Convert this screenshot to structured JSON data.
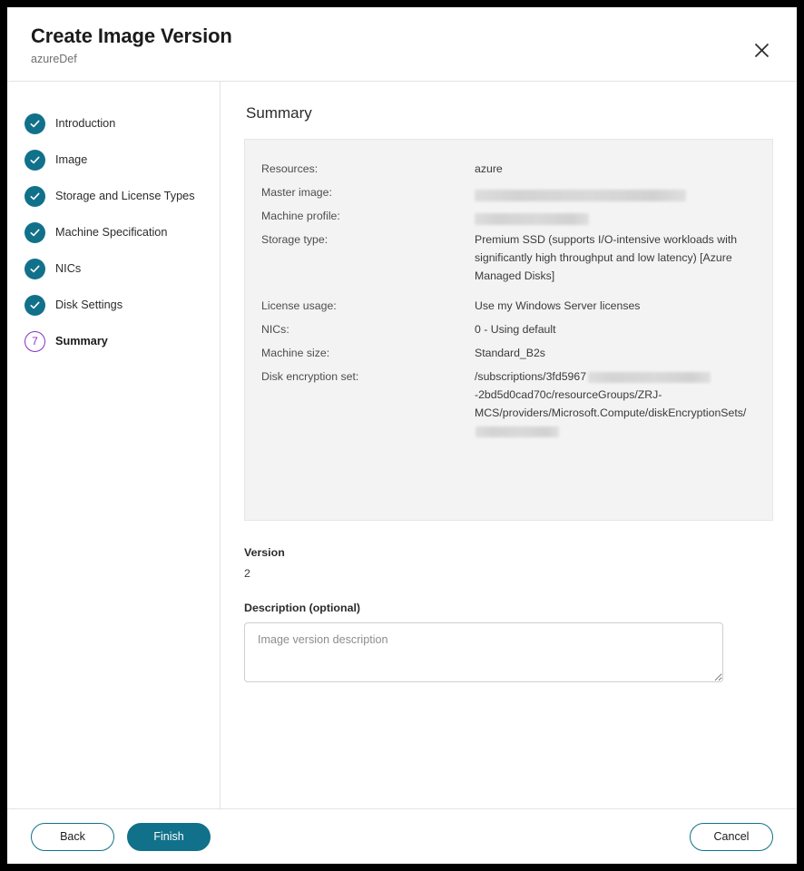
{
  "dialog": {
    "title": "Create Image Version",
    "subtitle": "azureDef",
    "close_icon": "close-icon"
  },
  "sidebar": {
    "steps": [
      {
        "label": "Introduction",
        "state": "done",
        "marker": "check"
      },
      {
        "label": "Image",
        "state": "done",
        "marker": "check"
      },
      {
        "label": "Storage and License Types",
        "state": "done",
        "marker": "check"
      },
      {
        "label": "Machine Specification",
        "state": "done",
        "marker": "check"
      },
      {
        "label": "NICs",
        "state": "done",
        "marker": "check"
      },
      {
        "label": "Disk Settings",
        "state": "done",
        "marker": "check"
      },
      {
        "label": "Summary",
        "state": "active",
        "marker": "7"
      }
    ]
  },
  "content": {
    "heading": "Summary",
    "summary": {
      "resources": {
        "label": "Resources:",
        "value": "azure"
      },
      "master_image": {
        "label": "Master image:",
        "value": ""
      },
      "machine_profile": {
        "label": "Machine profile:",
        "value": ""
      },
      "storage_type": {
        "label": "Storage type:",
        "value": "Premium SSD (supports I/O-intensive workloads with significantly high throughput and low latency) [Azure Managed Disks]"
      },
      "license_usage": {
        "label": "License usage:",
        "value": "Use my Windows Server licenses"
      },
      "nics": {
        "label": "NICs:",
        "value": "0 - Using default"
      },
      "machine_size": {
        "label": "Machine size:",
        "value": "Standard_B2s"
      },
      "disk_encryption_set": {
        "label": "Disk encryption set:",
        "value_part1": "/subscriptions/3fd5967",
        "value_part2": "-2bd5d0cad70c/resourceGroups/ZRJ-MCS/providers/Microsoft.Compute/diskEncryptionSets/"
      }
    },
    "version": {
      "label": "Version",
      "value": "2"
    },
    "description": {
      "label": "Description (optional)",
      "placeholder": "Image version description",
      "value": ""
    }
  },
  "footer": {
    "back_label": "Back",
    "finish_label": "Finish",
    "cancel_label": "Cancel"
  },
  "colors": {
    "accent_teal": "#11718a",
    "active_purple": "#8a30c4",
    "panel_gray": "#f3f3f3"
  }
}
